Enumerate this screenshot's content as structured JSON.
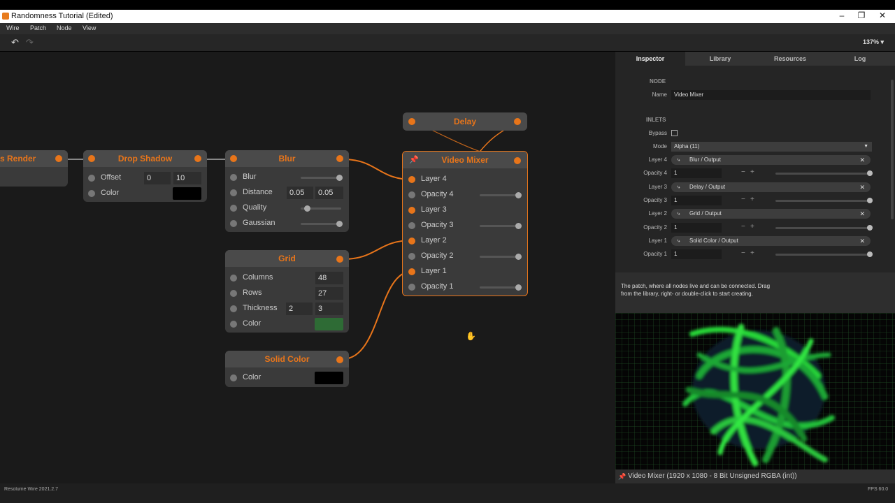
{
  "window": {
    "title": "Randomness Tutorial (Edited)"
  },
  "menu": [
    "Wire",
    "Patch",
    "Node",
    "View"
  ],
  "toolbar": {
    "zoom": "137% ▾",
    "undo_icon": "↶",
    "redo_icon": "↷"
  },
  "nodes": {
    "render": {
      "title": "Render",
      "title_visible": "s Render"
    },
    "drop_shadow": {
      "title": "Drop Shadow",
      "offset_label": "Offset",
      "offset_x": "0",
      "offset_y": "10",
      "color_label": "Color",
      "color": "#000000"
    },
    "blur": {
      "title": "Blur",
      "blur_label": "Blur",
      "blur_value": 1.0,
      "distance_label": "Distance",
      "distance_x": "0.05",
      "distance_y": "0.05",
      "quality_label": "Quality",
      "quality_value": 0.05,
      "gaussian_label": "Gaussian",
      "gaussian_value": 1.0
    },
    "grid": {
      "title": "Grid",
      "columns_label": "Columns",
      "columns": "48",
      "rows_label": "Rows",
      "rows": "27",
      "thickness_label": "Thickness",
      "thickness_x": "2",
      "thickness_y": "3",
      "color_label": "Color",
      "color": "#2e6b35"
    },
    "solid_color": {
      "title": "Solid Color",
      "color_label": "Color",
      "color": "#000000"
    },
    "delay": {
      "title": "Delay"
    },
    "video_mixer": {
      "title": "Video Mixer",
      "inputs": [
        {
          "label": "Layer 4",
          "connected": true
        },
        {
          "label": "Opacity 4",
          "connected": false,
          "value": 1.0
        },
        {
          "label": "Layer 3",
          "connected": true
        },
        {
          "label": "Opacity 3",
          "connected": false,
          "value": 1.0
        },
        {
          "label": "Layer 2",
          "connected": true
        },
        {
          "label": "Opacity 2",
          "connected": false,
          "value": 1.0
        },
        {
          "label": "Layer 1",
          "connected": true
        },
        {
          "label": "Opacity 1",
          "connected": false,
          "value": 1.0
        }
      ]
    }
  },
  "panel": {
    "tabs": [
      "Inspector",
      "Library",
      "Resources",
      "Log"
    ],
    "active_tab": "Inspector",
    "node_section": "NODE",
    "name_label": "Name",
    "name_value": "Video Mixer",
    "inlets_section": "INLETS",
    "bypass_label": "Bypass",
    "mode_label": "Mode",
    "mode_value": "Alpha (11)",
    "inlets": [
      {
        "label": "Layer 4",
        "conn": "Blur / Output",
        "op_label": "Opacity 4",
        "op_value": "1"
      },
      {
        "label": "Layer 3",
        "conn": "Delay / Output",
        "op_label": "Opacity 3",
        "op_value": "1"
      },
      {
        "label": "Layer 2",
        "conn": "Grid / Output",
        "op_label": "Opacity 2",
        "op_value": "1"
      },
      {
        "label": "Layer 1",
        "conn": "Solid Color / Output",
        "op_label": "Opacity 1",
        "op_value": "1"
      }
    ],
    "help_line1": "The patch, where all nodes live and can be connected. Drag",
    "help_line2": "from the library, right- or double-click to start creating.",
    "preview_status": "Video Mixer (1920 x 1080 - 8 Bit Unsigned RGBA (int))"
  },
  "statusbar": {
    "left": "Resolume Wire 2021.2.7",
    "right": "FPS 60.0"
  },
  "colors": {
    "accent": "#e8751a",
    "canvas": "#1a1a1a",
    "node": "#3a3a3a",
    "wire": "#e8751a"
  }
}
